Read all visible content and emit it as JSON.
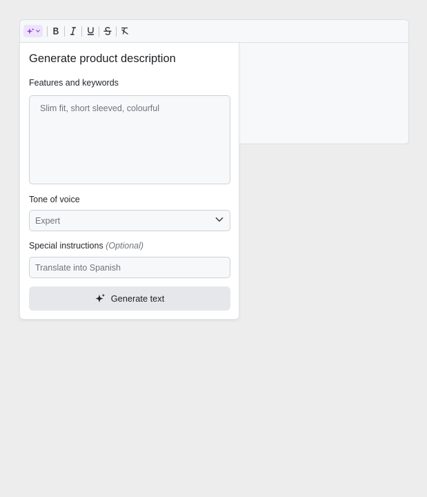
{
  "popover": {
    "title": "Generate product description",
    "features_label": "Features and keywords",
    "features_placeholder": "Slim fit, short sleeved, colourful",
    "tone_label": "Tone of voice",
    "tone_value": "Expert",
    "special_label": "Special instructions",
    "special_optional": "(Optional)",
    "special_placeholder": "Translate into Spanish",
    "generate_label": "Generate text"
  },
  "toolbar": {
    "buttons": [
      "ai-assistant-icon",
      "bold-icon",
      "italic-icon",
      "underline-icon",
      "strikethrough-icon",
      "clear-formatting-icon"
    ]
  },
  "colors": {
    "accent": "#8b3fd9",
    "ai_button_bg": "#ede3fb"
  }
}
